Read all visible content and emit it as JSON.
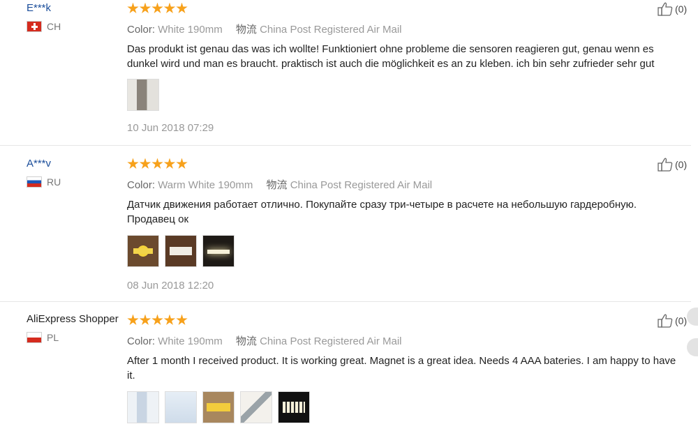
{
  "reviews": [
    {
      "user": "E***k",
      "country": "CH",
      "meta": {
        "color_label": "Color:",
        "color_value": "White 190mm",
        "logistics_label": "物流",
        "logistics_value": "China Post Registered Air Mail"
      },
      "text": "Das produkt ist genau das was ich wollte! Funktioniert ohne probleme die sensoren reagieren gut, genau wenn es dunkel wird und man es braucht. praktisch ist auch die möglichkeit es an zu kleben. ich bin sehr zufrieder sehr gut",
      "date": "10 Jun 2018 07:29",
      "helpful": "(0)"
    },
    {
      "user": "A***v",
      "country": "RU",
      "meta": {
        "color_label": "Color:",
        "color_value": "Warm White 190mm",
        "logistics_label": "物流",
        "logistics_value": "China Post Registered Air Mail"
      },
      "text": "Датчик движения работает отлично. Покупайте сразу три-четыре в расчете на небольшую гардеробную. Продавец ок",
      "date": "08 Jun 2018 12:20",
      "helpful": "(0)"
    },
    {
      "user": "AliExpress Shopper",
      "country": "PL",
      "meta": {
        "color_label": "Color:",
        "color_value": "White 190mm",
        "logistics_label": "物流",
        "logistics_value": "China Post Registered Air Mail"
      },
      "text": "After 1 month I received product. It is working great. Magnet is a great idea. Needs 4 AAA bateries. I am happy to have it.",
      "helpful": "(0)"
    }
  ],
  "icons": {
    "star": "star-icon",
    "thumbs_up": "thumbs-up-icon"
  },
  "colors": {
    "star": "#f7a11b",
    "username": "#1a4d9a",
    "muted": "#999999"
  }
}
